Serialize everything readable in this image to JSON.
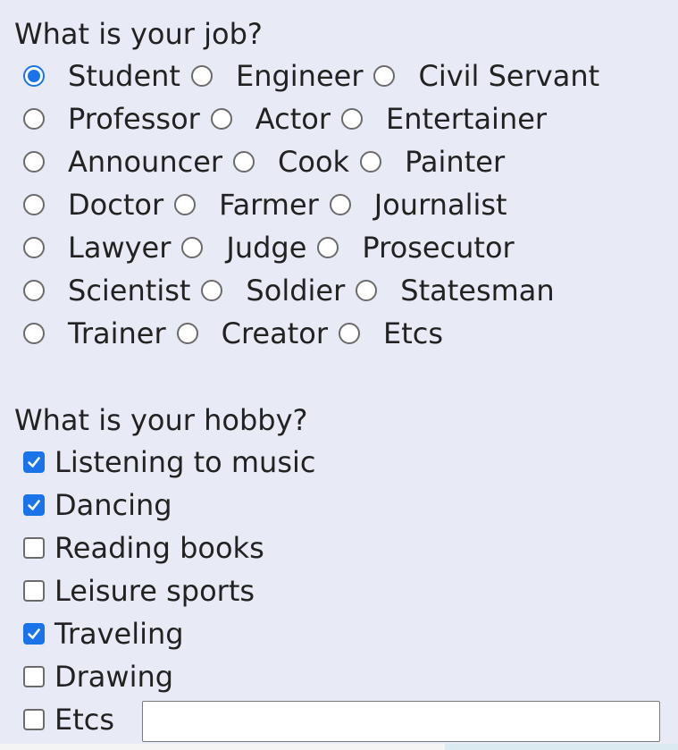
{
  "job": {
    "question": "What is your job?",
    "rows": [
      [
        "Student",
        "Engineer",
        "Civil Servant"
      ],
      [
        "Professor",
        "Actor",
        "Entertainer"
      ],
      [
        "Announcer",
        "Cook",
        "Painter"
      ],
      [
        "Doctor",
        "Farmer",
        "Journalist"
      ],
      [
        "Lawyer",
        "Judge",
        "Prosecutor"
      ],
      [
        "Scientist",
        "Soldier",
        "Statesman"
      ],
      [
        "Trainer",
        "Creator",
        "Etcs"
      ]
    ],
    "selected": "Student"
  },
  "hobby": {
    "question": "What is your hobby?",
    "items": [
      {
        "label": "Listening to music",
        "checked": true
      },
      {
        "label": "Dancing",
        "checked": true
      },
      {
        "label": "Reading books",
        "checked": false
      },
      {
        "label": "Leisure sports",
        "checked": false
      },
      {
        "label": "Traveling",
        "checked": true
      },
      {
        "label": "Drawing",
        "checked": false
      },
      {
        "label": "Etcs",
        "checked": false
      }
    ],
    "etc_value": ""
  },
  "colors": {
    "accent": "#1a73e8",
    "background": "#e8eaf5"
  }
}
